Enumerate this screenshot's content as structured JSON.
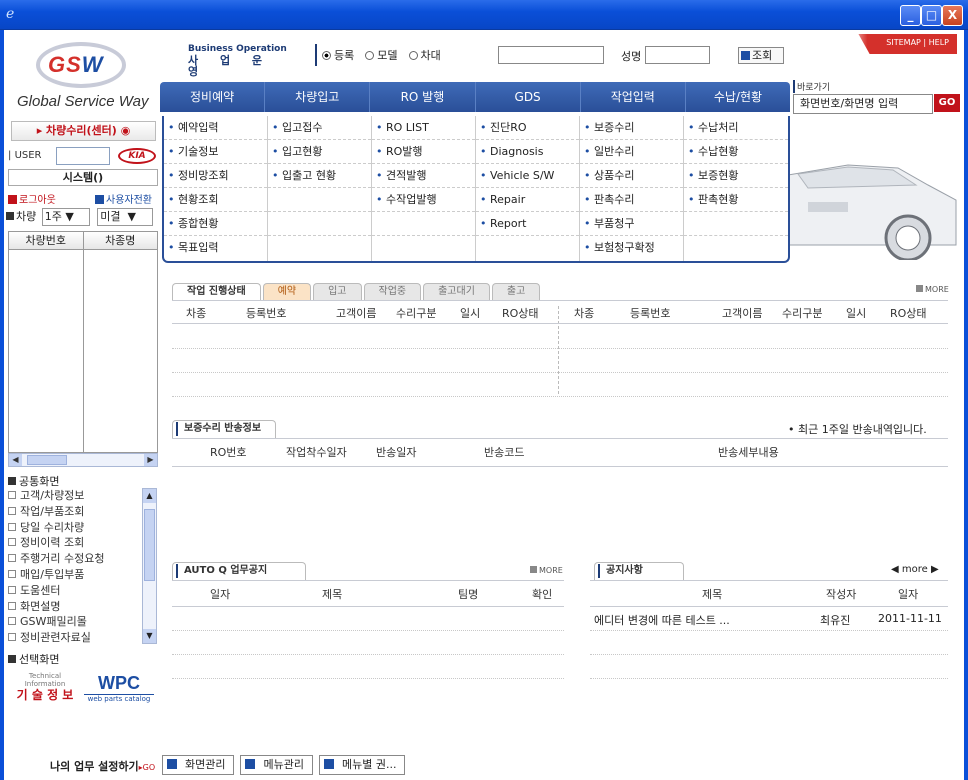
{
  "window": {
    "min": "_",
    "max": "□",
    "close": "X"
  },
  "logo": {
    "gs": "GS",
    "w": "W",
    "tagline": "Global Service Way"
  },
  "left": {
    "center_button": "▸ 차량수리(센터)",
    "user_label": "USER",
    "kia": "KIA",
    "system": "시스템()",
    "logout": "로그아웃",
    "user_switch": "사용자전환",
    "car_label": "차량",
    "week_value": "1주",
    "status_value": "미결",
    "grid_cols": [
      "차량번호",
      "차종명"
    ],
    "common_title": "공통화면",
    "common_items": [
      "고객/차량정보",
      "작업/부품조회",
      "당일 수리차량",
      "정비이력 조회",
      "주행거리 수정요청",
      "매입/투입부품",
      "도움센터",
      "화면설명",
      "GSW패밀리몰",
      "정비관련자료실"
    ],
    "select_title": "선택화면",
    "tech_top": "Technical\nInformation",
    "tech_kr": "기 술 정 보",
    "wpc": "WPC",
    "wpc_sub": "web parts catalog",
    "mywork": "나의 업무 설정하기",
    "mywork_go": "▸GO"
  },
  "header": {
    "biz_en": "Business Operation",
    "biz_ko": "사 업 운 영",
    "radio": [
      "등록",
      "모델",
      "차대"
    ],
    "name_label": "성명",
    "lookup": "조회",
    "sitemap": "SITEMAP | HELP",
    "shortcut_label": "바로가기",
    "shortcut_value": "화면번호/화면명 입력",
    "go": "GO"
  },
  "nav": [
    "정비예약",
    "차량입고",
    "RO 발행",
    "GDS",
    "작업입력",
    "수납/현황"
  ],
  "dropdown": [
    [
      "예약입력",
      "기술정보",
      "정비망조회",
      "현황조회",
      "종합현황",
      "목표입력"
    ],
    [
      "입고접수",
      "입고현황",
      "입출고 현황",
      "",
      "",
      ""
    ],
    [
      "RO LIST",
      "RO발행",
      "견적발행",
      "수작업발행",
      "",
      ""
    ],
    [
      "진단RO",
      "Diagnosis",
      "Vehicle S/W",
      "Repair",
      "Report",
      ""
    ],
    [
      "보증수리",
      "일반수리",
      "상품수리",
      "판촉수리",
      "부품청구",
      "보험청구확정"
    ],
    [
      "수납처리",
      "수납현황",
      "보증현황",
      "판촉현황",
      "",
      ""
    ]
  ],
  "work": {
    "tabs": [
      "작업 진행상태",
      "예약",
      "입고",
      "작업중",
      "출고대기",
      "출고"
    ],
    "more": "MORE",
    "cols_left": [
      "차종",
      "등록번호",
      "고객이름",
      "수리구분",
      "일시",
      "RO상태"
    ],
    "cols_right": [
      "차종",
      "등록번호",
      "고객이름",
      "수리구분",
      "일시",
      "RO상태"
    ]
  },
  "warranty": {
    "title": "보증수리 반송정보",
    "note": "• 최근 1주일 반송내역입니다.",
    "cols": [
      "RO번호",
      "작업착수일자",
      "반송일자",
      "반송코드",
      "반송세부내용"
    ]
  },
  "autoq": {
    "title": "AUTO Q 업무공지",
    "more": "MORE",
    "cols": [
      "일자",
      "제목",
      "팀명",
      "확인"
    ]
  },
  "notice": {
    "title": "공지사항",
    "more": "◀ more ▶",
    "cols": [
      "제목",
      "작성자",
      "일자"
    ],
    "rows": [
      {
        "title": "에디터 변경에 따른 테스트 ...",
        "author": "최유진",
        "date": "2011-11-11"
      }
    ]
  },
  "bottom_tabs": [
    "화면관리",
    "메뉴관리",
    "메뉴별 권..."
  ]
}
